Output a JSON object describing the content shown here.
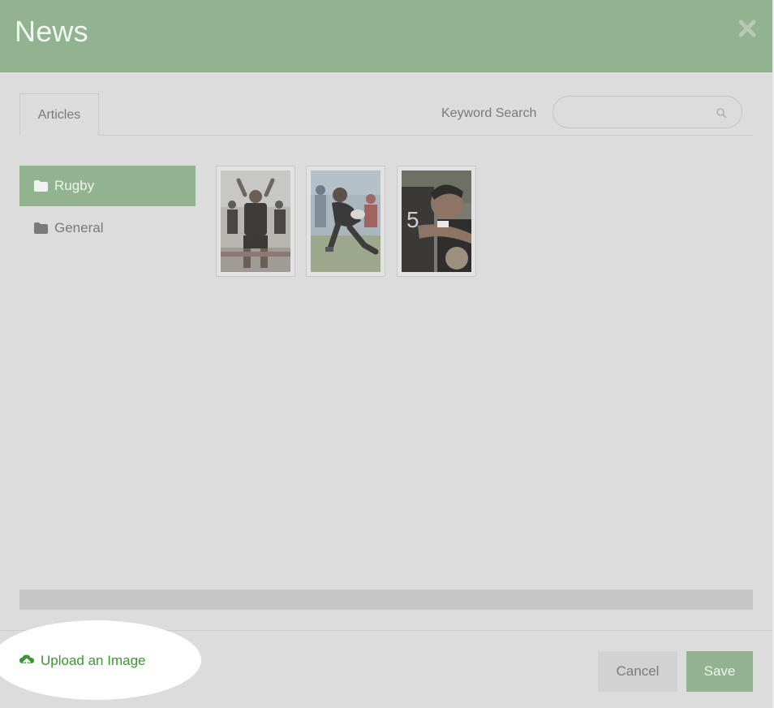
{
  "dialog": {
    "title": "News"
  },
  "tabs": [
    {
      "label": "Articles"
    }
  ],
  "search": {
    "label": "Keyword Search",
    "placeholder": "",
    "value": ""
  },
  "folders": [
    {
      "label": "Rugby",
      "active": true
    },
    {
      "label": "General",
      "active": false
    }
  ],
  "footer": {
    "upload_label": "Upload an Image",
    "cancel_label": "Cancel",
    "save_label": "Save"
  },
  "colors": {
    "header": "#92b38f",
    "accent_green": "#3e9434",
    "overlay": "#dcdcdc"
  },
  "icons": [
    "close-icon",
    "search-icon",
    "folder-icon",
    "cloud-upload-icon"
  ]
}
